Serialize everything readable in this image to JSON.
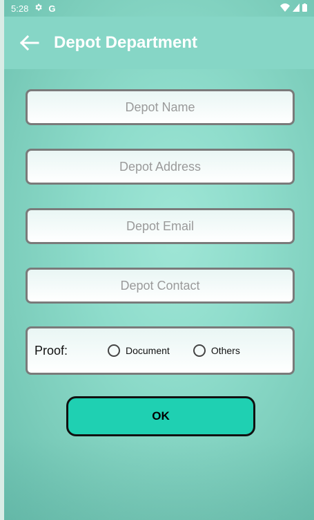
{
  "status_bar": {
    "time": "5:28",
    "settings_icon": "gear-icon",
    "g_label": "G",
    "wifi_icon": "wifi-icon",
    "signal_icon": "signal-icon",
    "battery_icon": "battery-icon"
  },
  "app_bar": {
    "back_icon": "arrow-left-icon",
    "title": "Depot Department"
  },
  "form": {
    "depot_name": {
      "placeholder": "Depot Name",
      "value": ""
    },
    "depot_address": {
      "placeholder": "Depot Address",
      "value": ""
    },
    "depot_email": {
      "placeholder": "Depot Email",
      "value": ""
    },
    "depot_contact": {
      "placeholder": "Depot Contact",
      "value": ""
    },
    "proof": {
      "label": "Proof:",
      "options": [
        {
          "label": "Document",
          "selected": false
        },
        {
          "label": "Others",
          "selected": false
        }
      ]
    },
    "ok_label": "OK"
  },
  "colors": {
    "app_bar": "#86d6c6",
    "button": "#1fd0b2",
    "field_border": "#7a7a7a"
  }
}
